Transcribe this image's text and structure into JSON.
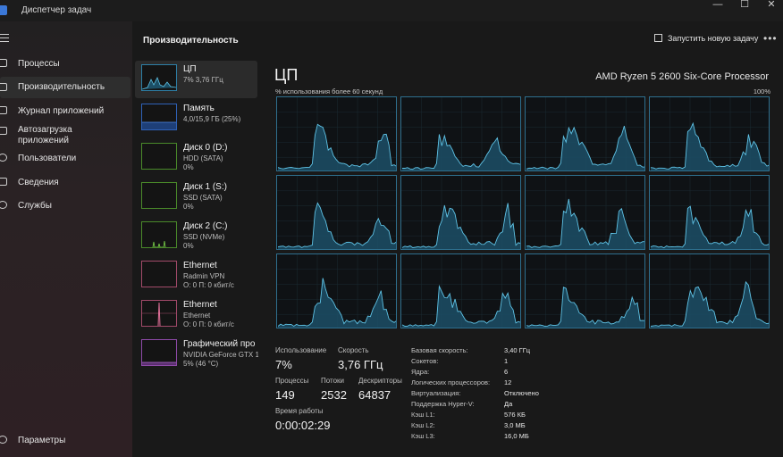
{
  "window": {
    "title": "Диспетчер задач",
    "minimize_glyph": "—",
    "maximize_glyph": "☐",
    "close_glyph": "✕"
  },
  "nav": {
    "items": [
      {
        "label": "Процессы",
        "icon": "processes-icon"
      },
      {
        "label": "Производительность",
        "icon": "performance-icon"
      },
      {
        "label": "Журнал приложений",
        "icon": "app-history-icon"
      },
      {
        "label": "Автозагрузка\nприложений",
        "icon": "startup-icon"
      },
      {
        "label": "Пользователи",
        "icon": "users-icon"
      },
      {
        "label": "Сведения",
        "icon": "details-icon"
      },
      {
        "label": "Службы",
        "icon": "services-icon"
      }
    ],
    "settings": {
      "label": "Параметры",
      "icon": "gear-icon"
    }
  },
  "header": {
    "title": "Производительность",
    "run_task": "Запустить новую задачу",
    "more": "•••"
  },
  "resources": [
    {
      "name": "ЦП",
      "sub": "7% 3,76 ГГц",
      "sub2": "",
      "type": "cpu"
    },
    {
      "name": "Память",
      "sub": "4,0/15,9 ГБ (25%)",
      "sub2": "",
      "type": "mem"
    },
    {
      "name": "Диск 0 (D:)",
      "sub": "HDD (SATA)",
      "sub2": "0%",
      "type": "disk"
    },
    {
      "name": "Диск 1 (S:)",
      "sub": "SSD (SATA)",
      "sub2": "0%",
      "type": "disk"
    },
    {
      "name": "Диск 2 (C:)",
      "sub": "SSD (NVMe)",
      "sub2": "0%",
      "type": "disk"
    },
    {
      "name": "Ethernet",
      "sub": "Radmin VPN",
      "sub2": "О: 0 П: 0 кбит/с",
      "type": "eth"
    },
    {
      "name": "Ethernet",
      "sub": "Ethernet",
      "sub2": "О: 0 П: 0 кбит/с",
      "type": "eth"
    },
    {
      "name": "Графический про",
      "sub": "NVIDIA GeForce GTX 166",
      "sub2": "5% (46 °C)",
      "type": "gpu"
    }
  ],
  "cpu": {
    "heading": "ЦП",
    "model": "AMD Ryzen 5 2600 Six-Core Processor",
    "graph_caption": "% использования более 60 секунд",
    "graph_max": "100%",
    "stats": {
      "usage_label": "Использование",
      "usage_value": "7%",
      "speed_label": "Скорость",
      "speed_value": "3,76 ГГц",
      "processes_label": "Процессы",
      "processes_value": "149",
      "threads_label": "Потоки",
      "threads_value": "2532",
      "handles_label": "Дескрипторы",
      "handles_value": "64837",
      "uptime_label": "Время работы",
      "uptime_value": "0:00:02:29"
    },
    "info": [
      {
        "label": "Базовая скорость:",
        "value": "3,40 ГГц"
      },
      {
        "label": "Сокетов:",
        "value": "1"
      },
      {
        "label": "Ядра:",
        "value": "6"
      },
      {
        "label": "Логических процессоров:",
        "value": "12"
      },
      {
        "label": "Виртуализация:",
        "value": "Отключено"
      },
      {
        "label": "Поддержка Hyper-V:",
        "value": "Да"
      },
      {
        "label": "Кэш L1:",
        "value": "576 КБ"
      },
      {
        "label": "Кэш L2:",
        "value": "3,0 МБ"
      },
      {
        "label": "Кэш L3:",
        "value": "16,0 МБ"
      }
    ]
  },
  "colors": {
    "accent": "#5fc3e6",
    "fill": "#1c4f66",
    "border": "#2e6f8e"
  }
}
